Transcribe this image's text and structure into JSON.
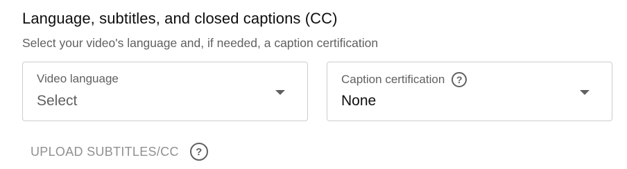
{
  "section": {
    "title": "Language, subtitles, and closed captions (CC)",
    "subtitle": "Select your video's language and, if needed, a caption certification"
  },
  "video_language": {
    "label": "Video language",
    "value": "Select",
    "icon": "chevron-down-icon"
  },
  "caption_certification": {
    "label": "Caption certification",
    "value": "None",
    "help_icon": "help-icon",
    "icon": "chevron-down-icon"
  },
  "upload": {
    "label": "UPLOAD SUBTITLES/CC",
    "help_icon": "help-icon"
  },
  "colors": {
    "title": "#0d0d0d",
    "secondary_text": "#606060",
    "disabled_text": "#909090",
    "border": "#cccccc"
  }
}
